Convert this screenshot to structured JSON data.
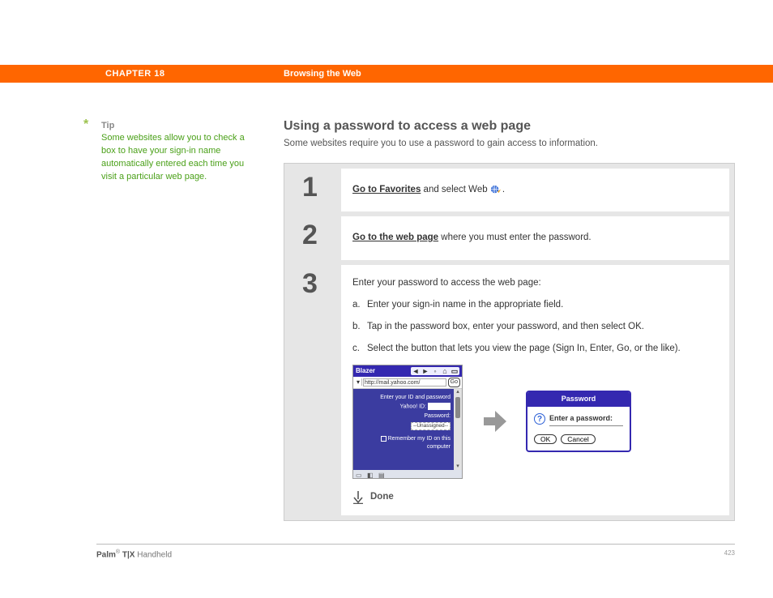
{
  "header": {
    "chapter": "CHAPTER 18",
    "title": "Browsing the Web"
  },
  "tip": {
    "marker": "*",
    "label": "Tip",
    "body": "Some websites allow you to check a box to have your sign-in name automatically entered each time you visit a particular web page."
  },
  "section": {
    "heading": "Using a password to access a web page",
    "intro": "Some websites require you to use a password to gain access to information."
  },
  "steps": [
    {
      "num": "1",
      "link": "Go to Favorites",
      "after": " and select Web ",
      "icon_period": "."
    },
    {
      "num": "2",
      "link": "Go to the web page",
      "after": " where you must enter the password."
    },
    {
      "num": "3",
      "lead": "Enter your password to access the web page:",
      "subs": [
        {
          "lbl": "a.",
          "txt": "Enter your sign-in name in the appropriate field."
        },
        {
          "lbl": "b.",
          "txt": "Tap in the password box, enter your password, and then select OK."
        },
        {
          "lbl": "c.",
          "txt": "Select the button that lets you view the page (Sign In, Enter, Go, or the like)."
        }
      ],
      "done": "Done"
    }
  ],
  "blazer": {
    "app": "Blazer",
    "url": "http://mail.yahoo.com/",
    "go": "Go",
    "prompt1": "Enter your ID and password",
    "id_label": "Yahoo! ID:",
    "pw_label": "Password:",
    "unassigned": "--Unassigned--",
    "remember": "Remember my ID on this computer"
  },
  "dialog": {
    "title": "Password",
    "prompt": "Enter a password:",
    "ok": "OK",
    "cancel": "Cancel"
  },
  "footer": {
    "brand_bold": "Palm",
    "brand_reg": "®",
    "brand_model": " T|X",
    "brand_suffix": " Handheld",
    "page": "423"
  }
}
